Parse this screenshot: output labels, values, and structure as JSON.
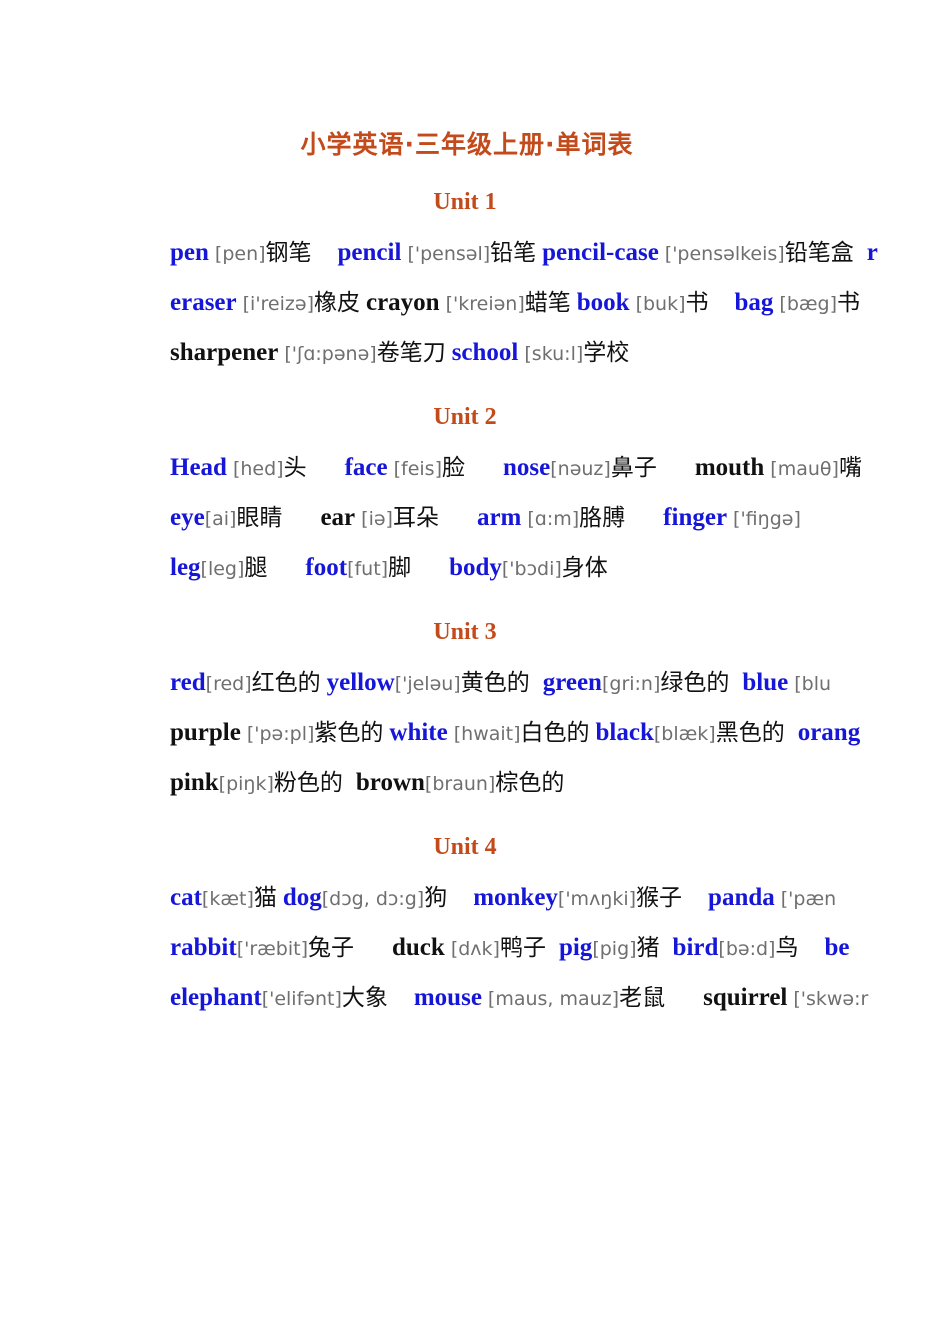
{
  "document": {
    "title": "小学英语·三年级上册·单词表",
    "title_color": "#C34A1B",
    "word_color_blue": "#1616D8",
    "word_color_black": "#111111",
    "phonetic_color": "#6F6F6F"
  },
  "units": [
    {
      "heading": "Unit 1",
      "lines": [
        {
          "entries": [
            {
              "word": "pen",
              "color": "blue",
              "phonetic": "[pen]",
              "chinese": "钢笔",
              "gap_after": "l"
            },
            {
              "word": "pencil",
              "color": "blue",
              "phonetic": "['pensəl]",
              "chinese": "铅笔",
              "gap_after": "s"
            },
            {
              "word": "pencil-case",
              "color": "blue",
              "phonetic": "['pensəlkeis]",
              "chinese": "铅笔盒",
              "gap_after": "m"
            },
            {
              "word": "r",
              "color": "blue",
              "phonetic": "",
              "chinese": "",
              "gap_after": "s"
            }
          ]
        },
        {
          "entries": [
            {
              "word": "eraser",
              "color": "blue",
              "phonetic": "[i'reizə]",
              "chinese": "橡皮",
              "gap_after": "s"
            },
            {
              "word": "crayon",
              "color": "black",
              "phonetic": "['kreiən]",
              "chinese": "蜡笔",
              "gap_after": "s"
            },
            {
              "word": "book",
              "color": "blue",
              "phonetic": "[buk]",
              "chinese": "书",
              "gap_after": "l"
            },
            {
              "word": "bag",
              "color": "blue",
              "phonetic": "[bæg]",
              "chinese": "书",
              "gap_after": "s"
            }
          ]
        },
        {
          "entries": [
            {
              "word": "sharpener",
              "color": "black",
              "phonetic": "['ʃɑ:pənə]",
              "chinese": "卷笔刀",
              "gap_after": "s"
            },
            {
              "word": "school",
              "color": "blue",
              "phonetic": "[sku:l]",
              "chinese": "学校",
              "gap_after": "s"
            }
          ]
        }
      ]
    },
    {
      "heading": "Unit 2",
      "lines": [
        {
          "entries": [
            {
              "word": "Head",
              "color": "blue",
              "phonetic": "[hed]",
              "chinese": "头",
              "gap_after": "xl"
            },
            {
              "word": "face",
              "color": "blue",
              "phonetic": "[feis]",
              "chinese": "脸",
              "gap_after": "xl"
            },
            {
              "word": "nose",
              "color": "blue",
              "phonetic": "[nəuz]",
              "chinese": "鼻子",
              "gap_after": "xl",
              "tight": true
            },
            {
              "word": "mouth",
              "color": "black",
              "phonetic": "[mauθ]",
              "chinese": "嘴",
              "gap_after": "s"
            }
          ]
        },
        {
          "entries": [
            {
              "word": "eye",
              "color": "blue",
              "phonetic": "[ai]",
              "chinese": "眼睛",
              "gap_after": "xl",
              "tight": true
            },
            {
              "word": "ear",
              "color": "black",
              "phonetic": "[iə]",
              "chinese": "耳朵",
              "gap_after": "xl"
            },
            {
              "word": "arm",
              "color": "blue",
              "phonetic": "[ɑ:m]",
              "chinese": "胳膊",
              "gap_after": "xl"
            },
            {
              "word": "finger",
              "color": "blue",
              "phonetic": "['fiŋgə]",
              "chinese": "",
              "gap_after": "s"
            }
          ]
        },
        {
          "entries": [
            {
              "word": "leg",
              "color": "blue",
              "phonetic": "[leg]",
              "chinese": "腿",
              "gap_after": "xl",
              "tight": true
            },
            {
              "word": "foot",
              "color": "blue",
              "phonetic": "[fut]",
              "chinese": "脚",
              "gap_after": "xl",
              "tight": true
            },
            {
              "word": "body",
              "color": "blue",
              "phonetic": "['bɔdi]",
              "chinese": "身体",
              "gap_after": "s",
              "tight": true
            }
          ]
        }
      ]
    },
    {
      "heading": "Unit 3",
      "lines": [
        {
          "entries": [
            {
              "word": "red",
              "color": "blue",
              "phonetic": "[red]",
              "chinese": "红色的",
              "gap_after": "s",
              "tight": true
            },
            {
              "word": "yellow",
              "color": "blue",
              "phonetic": "['jeləu]",
              "chinese": "黄色的",
              "gap_after": "m",
              "tight": true
            },
            {
              "word": "green",
              "color": "blue",
              "phonetic": "[gri:n]",
              "chinese": "绿色的",
              "gap_after": "m",
              "tight": true
            },
            {
              "word": "blue",
              "color": "blue",
              "phonetic": "[blu",
              "chinese": "",
              "gap_after": "s"
            }
          ]
        },
        {
          "entries": [
            {
              "word": "purple",
              "color": "black",
              "phonetic": "['pə:pl]",
              "chinese": "紫色的",
              "gap_after": "s"
            },
            {
              "word": "white",
              "color": "blue",
              "phonetic": "[hwait]",
              "chinese": "白色的",
              "gap_after": "s"
            },
            {
              "word": "black",
              "color": "blue",
              "phonetic": "[blæk]",
              "chinese": "黑色的",
              "gap_after": "m",
              "tight": true
            },
            {
              "word": "orang",
              "color": "blue",
              "phonetic": "",
              "chinese": "",
              "gap_after": "s"
            }
          ]
        },
        {
          "entries": [
            {
              "word": "pink",
              "color": "black",
              "phonetic": "[piŋk]",
              "chinese": "粉色的",
              "gap_after": "m",
              "tight": true
            },
            {
              "word": "brown",
              "color": "black",
              "phonetic": "[braun]",
              "chinese": "棕色的",
              "gap_after": "s",
              "tight": true
            }
          ]
        }
      ]
    },
    {
      "heading": "Unit 4",
      "lines": [
        {
          "entries": [
            {
              "word": "cat",
              "color": "blue",
              "phonetic": "[kæt]",
              "chinese": "猫",
              "gap_after": "s",
              "tight": true
            },
            {
              "word": "dog",
              "color": "blue",
              "phonetic": "[dɔg, dɔ:g]",
              "chinese": "狗",
              "gap_after": "l",
              "tight": true
            },
            {
              "word": "monkey",
              "color": "blue",
              "phonetic": "['mʌŋki]",
              "chinese": "猴子",
              "gap_after": "l",
              "tight": true
            },
            {
              "word": "panda",
              "color": "blue",
              "phonetic": "['pæn",
              "chinese": "",
              "gap_after": "s"
            }
          ]
        },
        {
          "entries": [
            {
              "word": "rabbit",
              "color": "blue",
              "phonetic": "['ræbit]",
              "chinese": "兔子",
              "gap_after": "xl",
              "tight": true
            },
            {
              "word": "duck",
              "color": "black",
              "phonetic": "[dʌk]",
              "chinese": "鸭子",
              "gap_after": "m"
            },
            {
              "word": "pig",
              "color": "blue",
              "phonetic": "[pig]",
              "chinese": "猪",
              "gap_after": "m",
              "tight": true
            },
            {
              "word": "bird",
              "color": "blue",
              "phonetic": "[bə:d]",
              "chinese": "鸟",
              "gap_after": "l",
              "tight": true
            },
            {
              "word": "be",
              "color": "blue",
              "phonetic": "",
              "chinese": "",
              "gap_after": "s"
            }
          ]
        },
        {
          "entries": [
            {
              "word": "elephant",
              "color": "blue",
              "phonetic": "['elifənt]",
              "chinese": "大象",
              "gap_after": "l",
              "tight": true
            },
            {
              "word": "mouse",
              "color": "blue",
              "phonetic": "[maus, mauz]",
              "chinese": "老鼠",
              "gap_after": "xl"
            },
            {
              "word": "squirrel",
              "color": "black",
              "phonetic": "['skwə:r",
              "chinese": "",
              "gap_after": "s"
            }
          ]
        }
      ]
    }
  ]
}
